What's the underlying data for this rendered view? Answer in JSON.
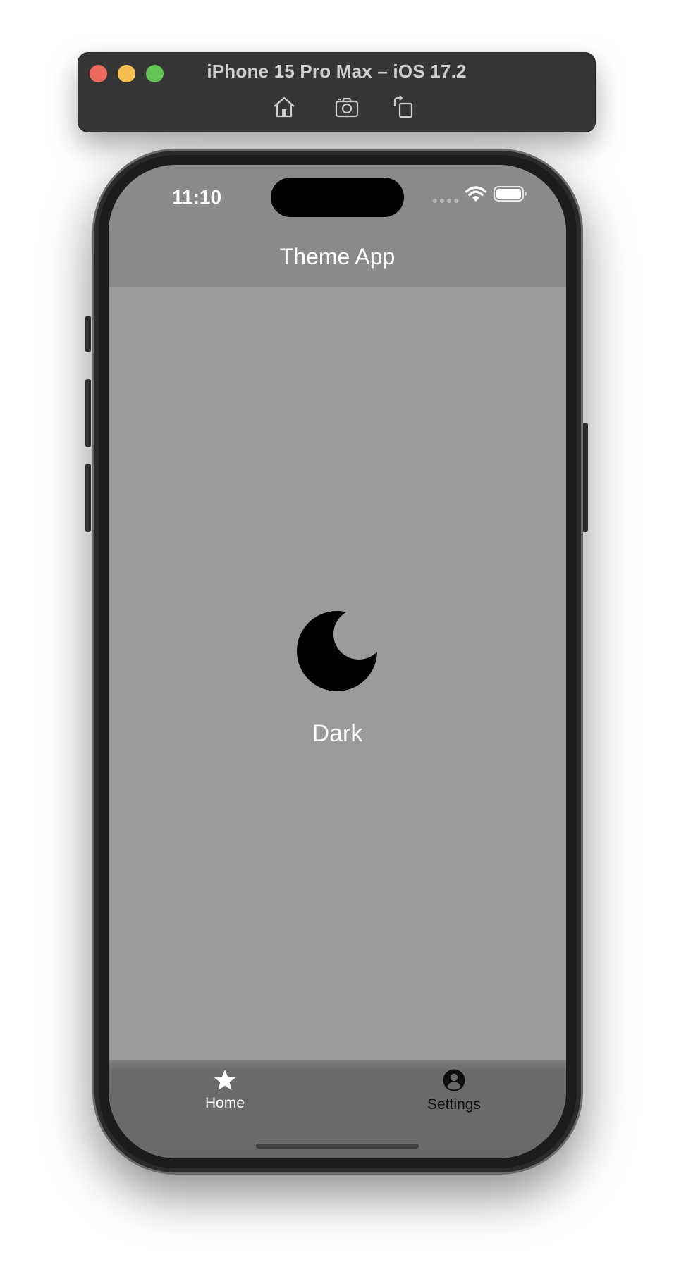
{
  "simulator": {
    "title": "iPhone 15 Pro Max – iOS 17.2",
    "tools": [
      {
        "icon": "home-icon"
      },
      {
        "icon": "screenshot-icon"
      },
      {
        "icon": "rotate-icon"
      }
    ]
  },
  "status_bar": {
    "time": "11:10"
  },
  "header": {
    "title": "Theme App"
  },
  "content": {
    "icon": "moon-icon",
    "label": "Dark"
  },
  "tabbar": {
    "items": [
      {
        "label": "Home",
        "icon": "star-icon",
        "active": true
      },
      {
        "label": "Settings",
        "icon": "account-circle-icon",
        "active": false
      }
    ]
  },
  "colors": {
    "screen_bg": "#9b9b9b",
    "header_bg": "#8a8a8a",
    "tabbar_bg": "#696969",
    "text_light": "#ffffff",
    "icon_dark": "#000000"
  }
}
